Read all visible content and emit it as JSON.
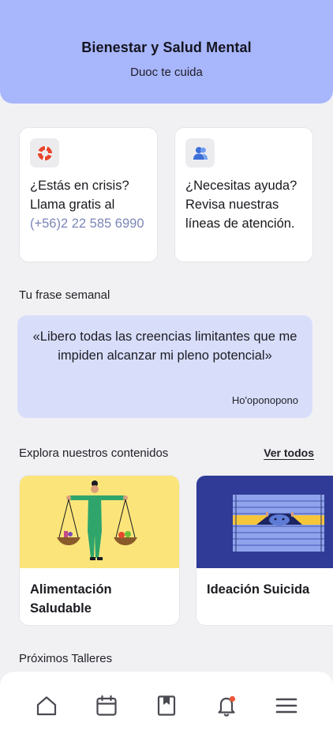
{
  "header": {
    "title": "Bienestar y Salud Mental",
    "subtitle": "Duoc te cuida"
  },
  "help_cards": [
    {
      "icon": "lifebuoy-icon",
      "text": "¿Estás en crisis? Llama gratis al",
      "phone": "(+56)2 22 585 6990"
    },
    {
      "icon": "support-person-icon",
      "text": "¿Necesitas ayuda?  Revisa nuestras líneas de atención."
    }
  ],
  "weekly_phrase": {
    "section_title": "Tu frase semanal",
    "quote": "«Libero todas las creencias limitantes que me impiden alcanzar mi pleno potencial»",
    "author": "Ho'oponopono"
  },
  "contents": {
    "section_title": "Explora nuestros contenidos",
    "see_all": "Ver todos",
    "items": [
      {
        "label": "Alimentación Saludable",
        "image": "balance-scale-illustration",
        "image_bg": "#fbe57a"
      },
      {
        "label": "Ideación Suicida",
        "image": "person-behind-blinds-illustration",
        "image_bg": "#2f3b97"
      }
    ]
  },
  "workshops": {
    "section_title": "Próximos Talleres"
  },
  "bottom_nav": [
    {
      "icon": "home-icon"
    },
    {
      "icon": "calendar-icon"
    },
    {
      "icon": "bookmark-book-icon"
    },
    {
      "icon": "bell-icon",
      "has_notification": true
    },
    {
      "icon": "menu-icon"
    }
  ],
  "colors": {
    "header_bg": "#a8b6fc",
    "quote_bg": "#d8defa",
    "phone_text": "#7b86b8",
    "notification_dot": "#f0563a"
  }
}
